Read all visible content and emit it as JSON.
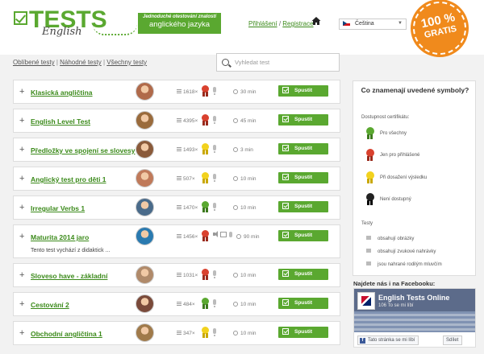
{
  "colors": {
    "brand_green": "#5aa830",
    "link_green": "#3b8a1a",
    "badge_orange": "#f08a1c"
  },
  "header": {
    "logo_title": "TESTS",
    "logo_sub": "English",
    "tagline_line1": "Jednoduché otestování znalostí",
    "tagline_line2": "anglického jazyka",
    "login": "Přihlášení",
    "separator": "/",
    "register": "Registrace",
    "language": "Čeština",
    "badge_line1": "100 %",
    "badge_line2": "GRATIS"
  },
  "filters": {
    "favorite": "Oblíbené testy",
    "random": "Náhodné testy",
    "all": "Všechny testy",
    "search_placeholder": "Vyhledat test"
  },
  "tests": [
    {
      "name": "Klasická angličtina",
      "count": "1618×",
      "medal": "red",
      "time": "30 min",
      "start": "Spustit",
      "avatar_color": "#b06a4a"
    },
    {
      "name": "English Level Test",
      "count": "4395×",
      "medal": "red",
      "time": "45 min",
      "start": "Spustit",
      "avatar_color": "#9a6b3c"
    },
    {
      "name": "Předložky ve spojení se slovesy",
      "count": "1493×",
      "medal": "yellow",
      "time": "3 min",
      "start": "Spustit",
      "avatar_color": "#8a5a3a"
    },
    {
      "name": "Anglický test pro děti 1",
      "count": "507×",
      "medal": "yellow",
      "time": "10 min",
      "start": "Spustit",
      "avatar_color": "#c07a5a"
    },
    {
      "name": "Irregular Verbs 1",
      "count": "1470×",
      "medal": "green",
      "time": "10 min",
      "start": "Spustit",
      "avatar_color": "#4a6b8a"
    },
    {
      "name": "Maturita 2014 jaro",
      "description": "Tento test vychází z didaktick ...",
      "count": "1456×",
      "medal": "red",
      "time": "90 min",
      "start": "Spustit",
      "avatar_color": "#2a7ab0"
    },
    {
      "name": "Sloveso have - základní",
      "count": "1031×",
      "medal": "red",
      "time": "10 min",
      "start": "Spustit",
      "avatar_color": "#b08a6a"
    },
    {
      "name": "Cestování 2",
      "count": "484×",
      "medal": "green",
      "time": "10 min",
      "start": "Spustit",
      "avatar_color": "#7a4a3a"
    },
    {
      "name": "Obchodní angličtina 1",
      "count": "347×",
      "medal": "yellow",
      "time": "10 min",
      "start": "Spustit",
      "avatar_color": "#a07a4a"
    }
  ],
  "legend": {
    "title": "Co znamenají uvedené symboly?",
    "availability_heading": "Dostupnost certifikátu:",
    "items": [
      {
        "color": "green",
        "label": "Pro všechny"
      },
      {
        "color": "red",
        "label": "Jen pro přihlášené"
      },
      {
        "color": "yellow",
        "label": "Při dosažení výsledku"
      },
      {
        "color": "black",
        "label": "Není dostupný"
      }
    ],
    "tests_heading": "Testy",
    "symbols": [
      {
        "icon": "image-icon",
        "label": "obsahují obrázky"
      },
      {
        "icon": "speaker-icon",
        "label": "obsahují zvukové nahrávky"
      },
      {
        "icon": "mic-icon",
        "label": "jsou nahrané rodilým mluvčím"
      }
    ]
  },
  "facebook": {
    "heading": "Najdete nás i na Facebooku:",
    "page_name": "English Tests Online",
    "likes": "106 To se mi líbí",
    "like_button": "Tato stránka se mi líbí",
    "share_button": "Sdílet"
  }
}
